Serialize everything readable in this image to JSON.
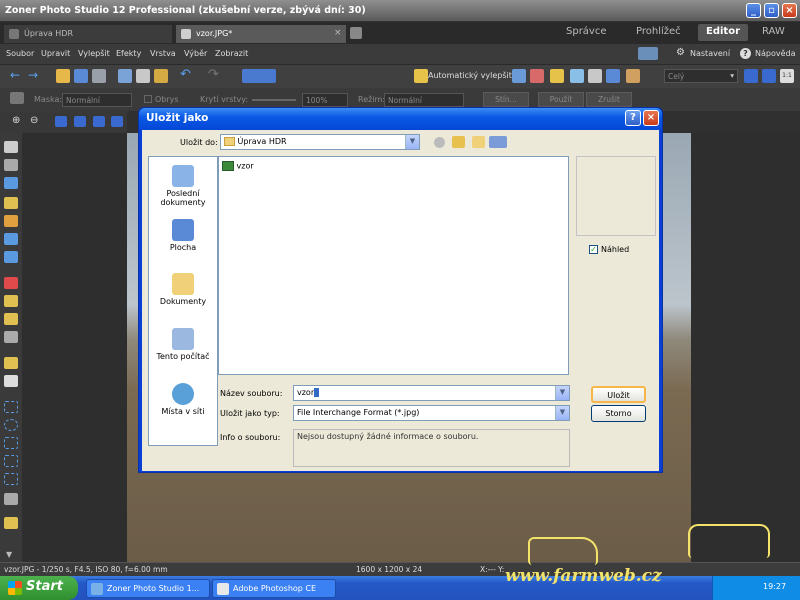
{
  "app": {
    "title": "Zoner Photo Studio 12 Professional (zkušební verze, zbývá dní: 30)"
  },
  "tabs": [
    {
      "label": "Úprava HDR"
    },
    {
      "label": "vzor.JPG*"
    }
  ],
  "modes": [
    "Správce",
    "Prohlížeč",
    "Editor",
    "RAW"
  ],
  "menu": [
    "Soubor",
    "Upravit",
    "Vylepšit",
    "Efekty",
    "Vrstva",
    "Výběr",
    "Zobrazit"
  ],
  "menu_right": {
    "settings": "Nastavení",
    "help": "Nápověda"
  },
  "toolbar": {
    "auto_enhance": "Automatický vylepšit",
    "zoom_select": "Celý",
    "zoom_step": "1:1"
  },
  "toolbar2": {
    "mask_label": "Maska:",
    "mask_value": "Normální",
    "outline_label": "Obrys",
    "opacity_label": "Krytí vrstvy:",
    "opacity_value": "100%",
    "mode_label": "Režim:",
    "mode_value": "Normální",
    "shadow_btn": "Stín...",
    "apply_btn": "Použít",
    "cancel_btn": "Zrušit"
  },
  "status": {
    "file_info": "vzor.JPG - 1/250 s, F4.5, ISO 80, f=6.00 mm",
    "dimensions": "1600 x 1200 x 24",
    "coords": "X:--- Y:"
  },
  "taskbar": {
    "start": "Start",
    "items": [
      "Zoner Photo Studio 1...",
      "Adobe Photoshop CE"
    ],
    "time": "19:27"
  },
  "watermark": "www.farmweb.cz",
  "dialog": {
    "title": "Uložit jako",
    "save_in_label": "Uložit do:",
    "save_in_value": "Úprava HDR",
    "places": [
      "Poslední dokumenty",
      "Plocha",
      "Dokumenty",
      "Tento počítač",
      "Místa v síti"
    ],
    "files": [
      {
        "name": "vzor"
      }
    ],
    "preview_label": "Náhled",
    "filename_label": "Název souboru:",
    "filename_value": "vzor",
    "type_label": "Uložit jako typ:",
    "type_value": "File Interchange Format (*.jpg)",
    "info_label": "Info o souboru:",
    "info_value": "Nejsou dostupný žádné informace o souboru.",
    "save_btn": "Uložit",
    "cancel_btn": "Storno"
  },
  "colors": {
    "accent": "#0a5ae6",
    "xp_taskbar": "#2452be",
    "app_bg": "#303030"
  }
}
